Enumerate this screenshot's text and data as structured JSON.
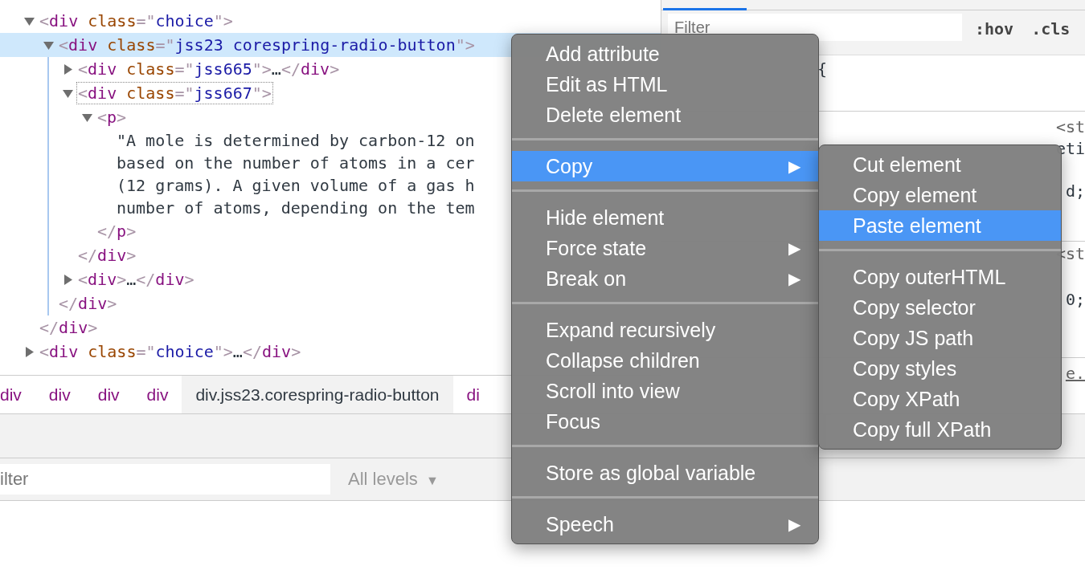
{
  "tree": [
    {
      "kind": "element",
      "expanded": true,
      "selected": false,
      "outlined": false,
      "parts": [
        {
          "kind": "bracket",
          "text": "<"
        },
        {
          "kind": "tag",
          "text": "div"
        },
        {
          "kind": "attr",
          "text": " class"
        },
        {
          "kind": "bracket",
          "text": "=\""
        },
        {
          "kind": "value",
          "text": "choice"
        },
        {
          "kind": "bracket",
          "text": "\">"
        }
      ],
      "children": [
        {
          "kind": "element",
          "expanded": true,
          "selected": true,
          "outlined": false,
          "parts": [
            {
              "kind": "bracket",
              "text": "<"
            },
            {
              "kind": "tag",
              "text": "div"
            },
            {
              "kind": "attr",
              "text": " class"
            },
            {
              "kind": "bracket",
              "text": "=\""
            },
            {
              "kind": "value",
              "text": "jss23 corespring-radio-button"
            },
            {
              "kind": "bracket",
              "text": "\">"
            }
          ],
          "children": [
            {
              "kind": "element",
              "expanded": false,
              "selected": false,
              "outlined": false,
              "parts": [
                {
                  "kind": "bracket",
                  "text": "<"
                },
                {
                  "kind": "tag",
                  "text": "div"
                },
                {
                  "kind": "attr",
                  "text": " class"
                },
                {
                  "kind": "bracket",
                  "text": "=\""
                },
                {
                  "kind": "value",
                  "text": "jss665"
                },
                {
                  "kind": "bracket",
                  "text": "\">"
                },
                {
                  "kind": "plain",
                  "text": "…"
                },
                {
                  "kind": "bracket",
                  "text": "</"
                },
                {
                  "kind": "tag",
                  "text": "div"
                },
                {
                  "kind": "bracket",
                  "text": ">"
                }
              ]
            },
            {
              "kind": "element",
              "expanded": true,
              "selected": false,
              "outlined": true,
              "parts": [
                {
                  "kind": "bracket",
                  "text": "<"
                },
                {
                  "kind": "tag",
                  "text": "div"
                },
                {
                  "kind": "attr",
                  "text": " class"
                },
                {
                  "kind": "bracket",
                  "text": "=\""
                },
                {
                  "kind": "value",
                  "text": "jss667"
                },
                {
                  "kind": "bracket",
                  "text": "\">"
                }
              ],
              "children": [
                {
                  "kind": "element",
                  "expanded": true,
                  "selected": false,
                  "outlined": false,
                  "parts": [
                    {
                      "kind": "bracket",
                      "text": "<"
                    },
                    {
                      "kind": "tag",
                      "text": "p"
                    },
                    {
                      "kind": "bracket",
                      "text": ">"
                    }
                  ],
                  "children": [
                    {
                      "kind": "text",
                      "lines": [
                        "\"A mole is determined by carbon-12 on",
                        "based on the number of atoms in a cer",
                        "(12 grams). A given volume of a gas h",
                        "number of atoms, depending on the tem"
                      ]
                    }
                  ],
                  "close_parts": [
                    {
                      "kind": "bracket",
                      "text": "</"
                    },
                    {
                      "kind": "tag",
                      "text": "p"
                    },
                    {
                      "kind": "bracket",
                      "text": ">"
                    }
                  ]
                }
              ],
              "close_parts": [
                {
                  "kind": "bracket",
                  "text": "</"
                },
                {
                  "kind": "tag",
                  "text": "div"
                },
                {
                  "kind": "bracket",
                  "text": ">"
                }
              ]
            },
            {
              "kind": "element",
              "expanded": false,
              "selected": false,
              "outlined": false,
              "parts": [
                {
                  "kind": "bracket",
                  "text": "<"
                },
                {
                  "kind": "tag",
                  "text": "div"
                },
                {
                  "kind": "bracket",
                  "text": ">"
                },
                {
                  "kind": "plain",
                  "text": "…"
                },
                {
                  "kind": "bracket",
                  "text": "</"
                },
                {
                  "kind": "tag",
                  "text": "div"
                },
                {
                  "kind": "bracket",
                  "text": ">"
                }
              ]
            }
          ],
          "close_parts": [
            {
              "kind": "bracket",
              "text": "</"
            },
            {
              "kind": "tag",
              "text": "div"
            },
            {
              "kind": "bracket",
              "text": ">"
            }
          ]
        }
      ],
      "close_parts": [
        {
          "kind": "bracket",
          "text": "</"
        },
        {
          "kind": "tag",
          "text": "div"
        },
        {
          "kind": "bracket",
          "text": ">"
        }
      ]
    },
    {
      "kind": "element",
      "expanded": false,
      "selected": false,
      "outlined": false,
      "parts": [
        {
          "kind": "bracket",
          "text": "<"
        },
        {
          "kind": "tag",
          "text": "div"
        },
        {
          "kind": "attr",
          "text": " class"
        },
        {
          "kind": "bracket",
          "text": "=\""
        },
        {
          "kind": "value",
          "text": "choice"
        },
        {
          "kind": "bracket",
          "text": "\">"
        },
        {
          "kind": "plain",
          "text": "…"
        },
        {
          "kind": "bracket",
          "text": "</"
        },
        {
          "kind": "tag",
          "text": "div"
        },
        {
          "kind": "bracket",
          "text": ">"
        }
      ]
    }
  ],
  "breadcrumbs": [
    {
      "label": "div",
      "selected": false
    },
    {
      "label": "div",
      "selected": false
    },
    {
      "label": "div",
      "selected": false
    },
    {
      "label": "div",
      "selected": false
    },
    {
      "label": "div.jss23.corespring-radio-button",
      "selected": true
    },
    {
      "label": "di",
      "selected": false
    }
  ],
  "styles": {
    "filter": {
      "placeholder": "Filter"
    },
    "buttons": [
      ":hov",
      ".cls"
    ],
    "sections": [
      {
        "kind": "rule",
        "lines": [
          "{"
        ]
      },
      {
        "kind": "cut",
        "lines": [
          "<st",
          "eti",
          "d;"
        ]
      },
      {
        "kind": "cut",
        "lines": [
          "<st",
          "0;"
        ]
      },
      {
        "kind": "cut",
        "lines": [
          "e."
        ]
      }
    ]
  },
  "console": {
    "filter": {
      "placeholder": "ilter"
    },
    "levels": "All levels",
    "levels_caret": "▼"
  },
  "context_menu": {
    "groups": [
      {
        "items": [
          {
            "label": "Add attribute",
            "selected": false
          },
          {
            "label": "Edit as HTML",
            "selected": false
          },
          {
            "label": "Delete element",
            "selected": false
          }
        ]
      },
      {
        "items": [
          {
            "label": "Copy",
            "selected": true,
            "arrow": "▶"
          }
        ]
      },
      {
        "items": [
          {
            "label": "Hide element",
            "selected": false
          },
          {
            "label": "Force state",
            "selected": false,
            "arrow": "▶"
          },
          {
            "label": "Break on",
            "selected": false,
            "arrow": "▶"
          }
        ]
      },
      {
        "items": [
          {
            "label": "Expand recursively",
            "selected": false
          },
          {
            "label": "Collapse children",
            "selected": false
          },
          {
            "label": "Scroll into view",
            "selected": false
          },
          {
            "label": "Focus",
            "selected": false
          }
        ]
      },
      {
        "items": [
          {
            "label": "Store as global variable",
            "selected": false
          }
        ]
      },
      {
        "items": [
          {
            "label": "Speech",
            "selected": false,
            "arrow": "▶"
          }
        ]
      }
    ]
  },
  "submenu": {
    "groups": [
      {
        "items": [
          {
            "label": "Cut element",
            "selected": false
          },
          {
            "label": "Copy element",
            "selected": false
          },
          {
            "label": "Paste element",
            "selected": true
          }
        ]
      },
      {
        "items": [
          {
            "label": "Copy outerHTML",
            "selected": false
          },
          {
            "label": "Copy selector",
            "selected": false
          },
          {
            "label": "Copy JS path",
            "selected": false
          },
          {
            "label": "Copy styles",
            "selected": false
          },
          {
            "label": "Copy XPath",
            "selected": false
          },
          {
            "label": "Copy full XPath",
            "selected": false
          }
        ]
      }
    ]
  }
}
